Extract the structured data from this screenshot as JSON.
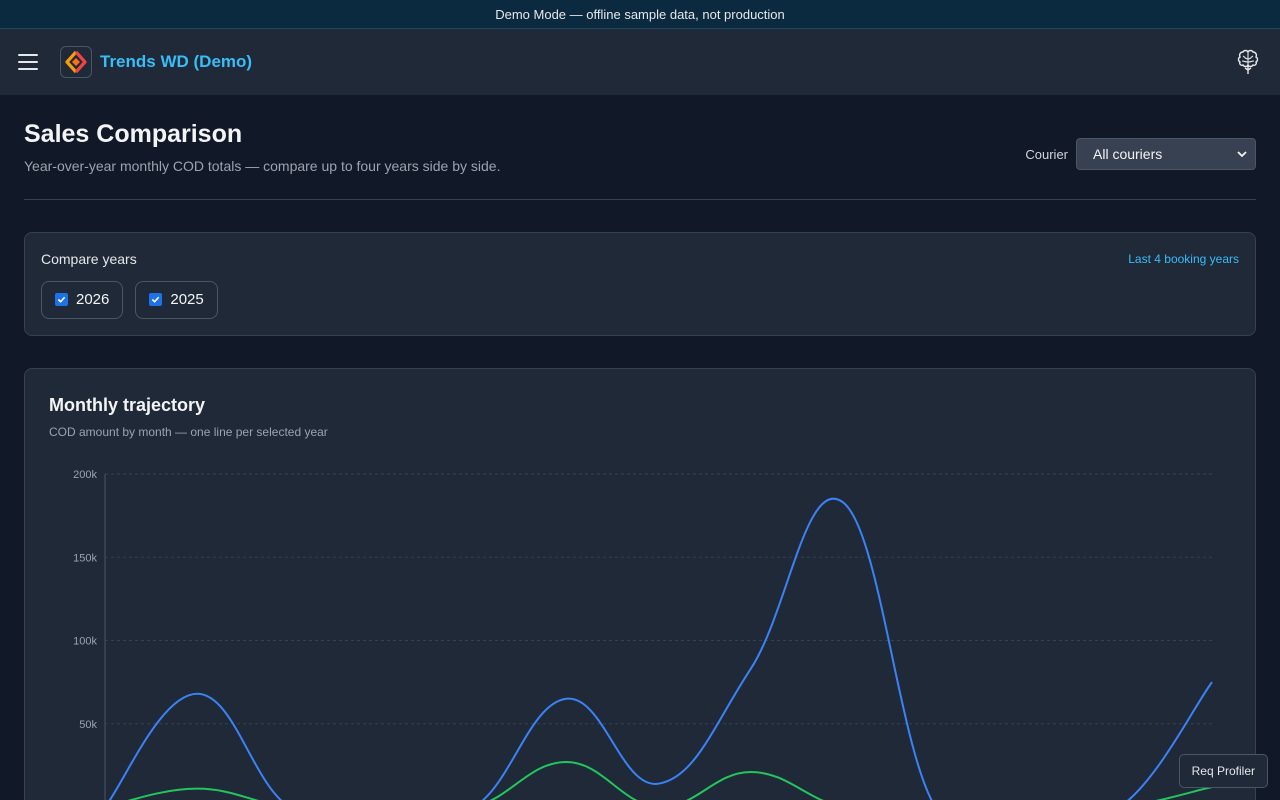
{
  "banner": {
    "text": "Demo Mode — offline sample data, not production"
  },
  "topbar": {
    "app_title": "Trends WD (Demo)"
  },
  "header": {
    "title": "Sales Comparison",
    "subtitle": "Year-over-year monthly COD totals — compare up to four years side by side.",
    "courier_label": "Courier",
    "courier_value": "All couriers"
  },
  "years": {
    "title": "Compare years",
    "link": "Last 4 booking years",
    "options": [
      {
        "label": "2026",
        "checked": true
      },
      {
        "label": "2025",
        "checked": true
      }
    ]
  },
  "chart": {
    "title": "Monthly trajectory",
    "subtitle": "COD amount by month — one line per selected year"
  },
  "chart_data": {
    "type": "line",
    "ylim": [
      0,
      200000
    ],
    "yticks": [
      {
        "value": 200000,
        "label": "200k"
      },
      {
        "value": 150000,
        "label": "150k"
      },
      {
        "value": 100000,
        "label": "100k"
      },
      {
        "value": 50000,
        "label": "50k"
      }
    ],
    "grid": true,
    "series": [
      {
        "color": "#3b82f6",
        "values": [
          0,
          68000,
          0,
          0,
          0,
          65000,
          14000,
          83000,
          183000,
          0,
          0,
          0,
          75000
        ]
      },
      {
        "color": "#22c55e",
        "values": [
          0,
          11000,
          0,
          0,
          0,
          27000,
          0,
          21000,
          0,
          0,
          0,
          0,
          12000
        ]
      }
    ]
  },
  "profiler": {
    "label": "Req Profiler"
  }
}
